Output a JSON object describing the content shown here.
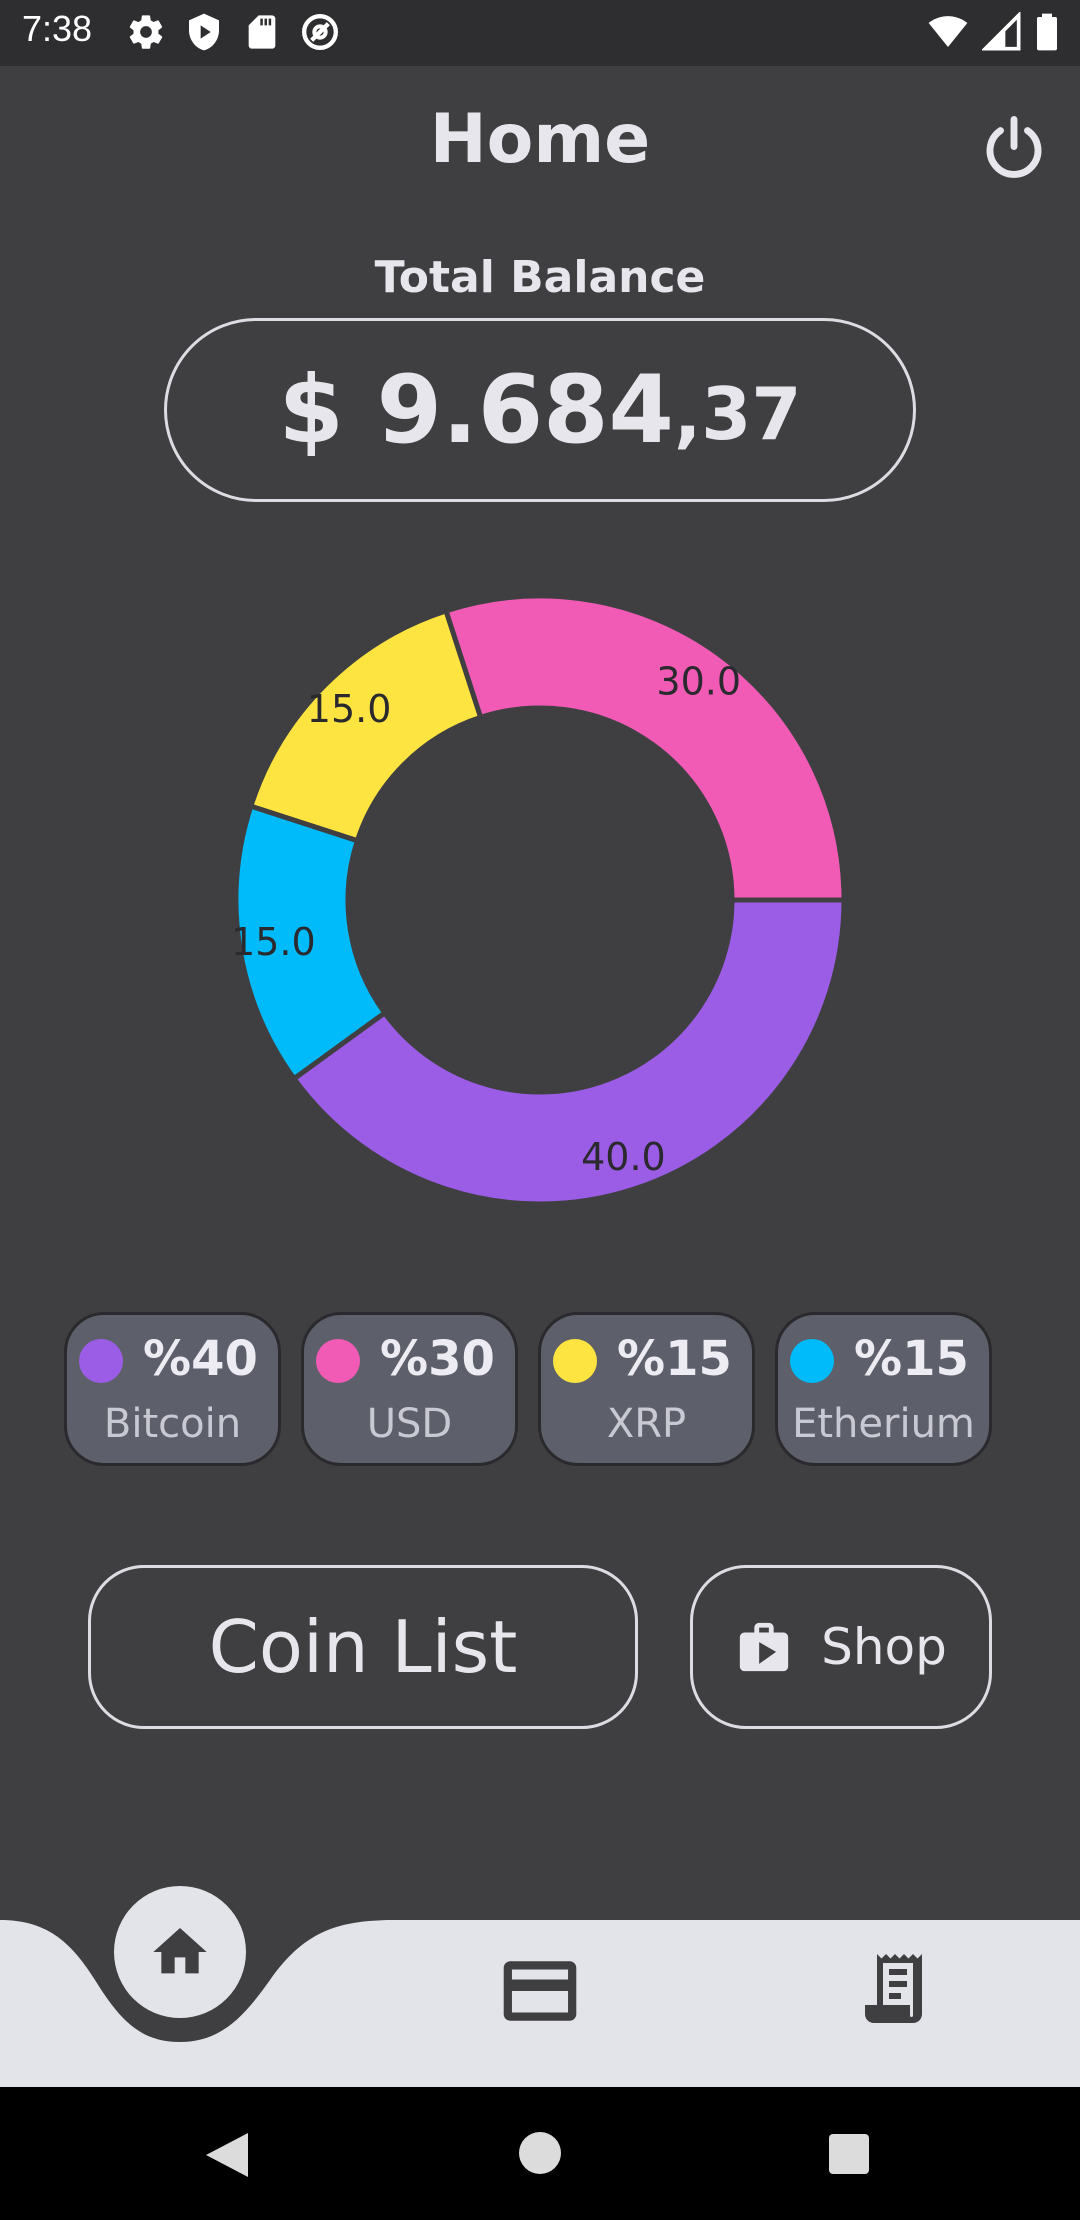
{
  "status_bar": {
    "time": "7:38",
    "left_icons": [
      "gear-icon",
      "shield-play-icon",
      "sd-card-icon",
      "at-sign-icon"
    ],
    "right_icons": [
      "wifi-icon",
      "cell-signal-icon",
      "battery-icon"
    ]
  },
  "header": {
    "title": "Home",
    "power_icon": "power-icon"
  },
  "balance": {
    "label": "Total Balance",
    "main": "$ 9.684",
    "cents": ",37"
  },
  "chart_data": {
    "type": "pie",
    "title": "",
    "categories": [
      "Bitcoin",
      "Etherium",
      "XRP",
      "USD"
    ],
    "values": [
      40.0,
      15.0,
      15.0,
      30.0
    ],
    "labels": [
      "40.0",
      "15.0",
      "15.0",
      "30.0"
    ],
    "colors": [
      "#9b5de5",
      "#00bbf9",
      "#fee440",
      "#f15bb5"
    ],
    "donut": true
  },
  "legend": [
    {
      "pct": "%40",
      "name": "Bitcoin",
      "color": "#9b5de5"
    },
    {
      "pct": "%30",
      "name": "USD",
      "color": "#f15bb5"
    },
    {
      "pct": "%15",
      "name": "XRP",
      "color": "#fee440"
    },
    {
      "pct": "%15",
      "name": "Etherium",
      "color": "#00bbf9"
    }
  ],
  "actions": {
    "coin_list": "Coin List",
    "shop": "Shop",
    "shop_icon": "shopping-bag-icon"
  },
  "bottom_nav": {
    "items": [
      "home-icon",
      "credit-card-icon",
      "receipt-icon"
    ],
    "active": "home-icon"
  },
  "colors": {
    "background": "#3f3f42",
    "nav_bar": "#e3e4ea",
    "legend_card": "#5d5f6a"
  }
}
